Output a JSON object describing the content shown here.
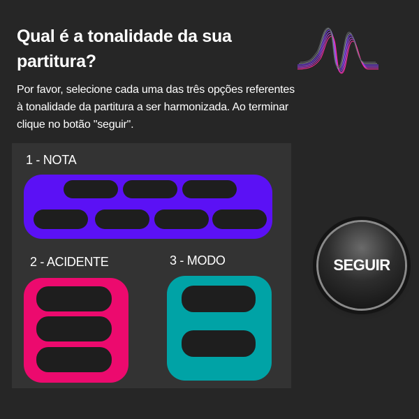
{
  "header": {
    "title": "Qual é a tonalidade da sua partitura?",
    "description": "Por favor, selecione cada uma das três opções referentes à tonalidade da partitura a ser harmonizada. Ao terminar clique no botão \"seguir\"."
  },
  "logo": {
    "icon": "soundwave-logo-icon",
    "colors": [
      "#7a3cff",
      "#ff2d9a",
      "#9aa0a6"
    ]
  },
  "sections": {
    "nota": {
      "label": "1 - NOTA",
      "color": "#5b11f5",
      "option_count": 7
    },
    "acidente": {
      "label": "2 - ACIDENTE",
      "color": "#ec0a6e",
      "option_count": 3
    },
    "modo": {
      "label": "3 - MODO",
      "color": "#00a3a6",
      "option_count": 2
    }
  },
  "seguir_button": {
    "label": "SEGUIR"
  }
}
